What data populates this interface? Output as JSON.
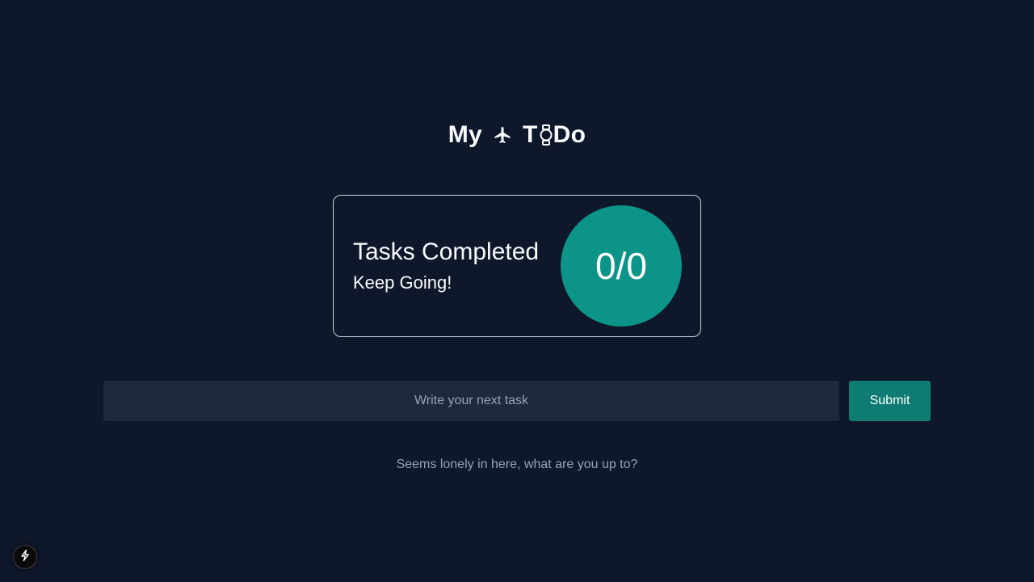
{
  "header": {
    "title_part1": "My",
    "title_part2": "T",
    "title_part3": "Do",
    "icons": [
      "airplane-icon",
      "watch-icon"
    ]
  },
  "summary": {
    "heading": "Tasks Completed",
    "subtext": "Keep Going!",
    "completed": 0,
    "total": 0,
    "progress_label": "0/0"
  },
  "form": {
    "input_value": "",
    "input_placeholder": "Write your next task",
    "submit_label": "Submit"
  },
  "tasks": [],
  "empty_state": "Seems lonely in here, what are you up to?",
  "dev_badge": {
    "icon": "lightning-bolt-icon"
  },
  "colors": {
    "background": "#0f172a",
    "accent": "#0d9488",
    "button": "#0f7c73",
    "input_bg": "#1e293b",
    "muted_text": "#94a3b8"
  }
}
